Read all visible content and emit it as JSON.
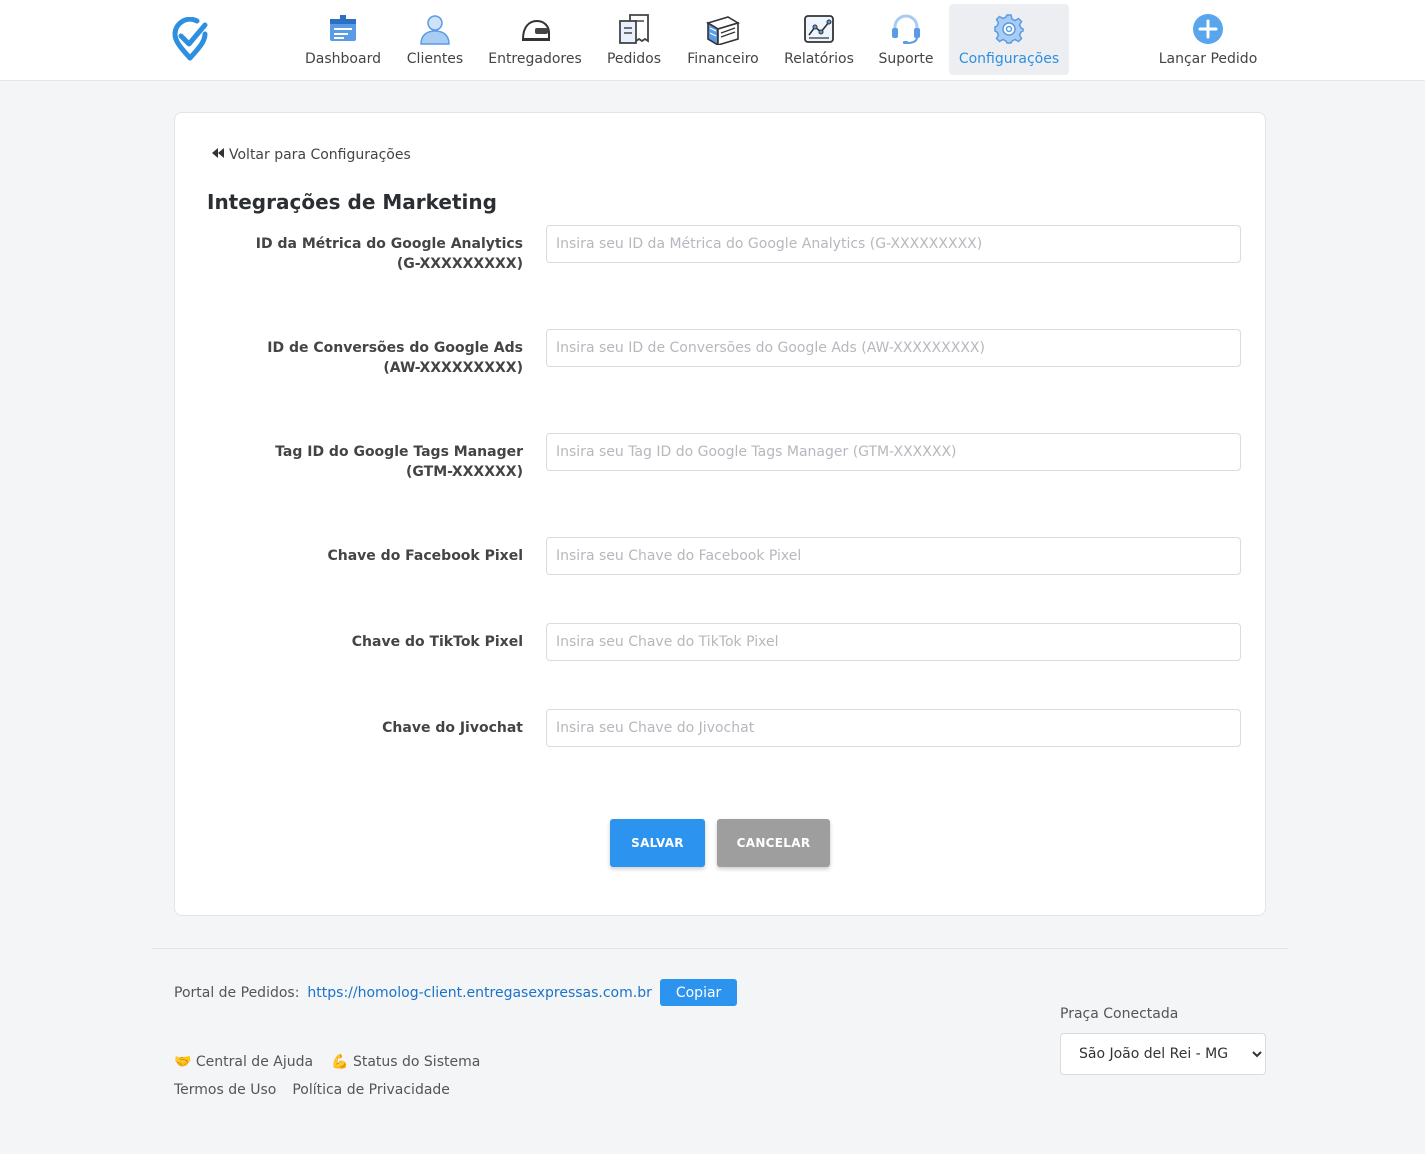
{
  "nav": {
    "items": [
      {
        "label": "Dashboard",
        "icon": "dashboard-icon"
      },
      {
        "label": "Clientes",
        "icon": "user-icon"
      },
      {
        "label": "Entregadores",
        "icon": "helmet-icon"
      },
      {
        "label": "Pedidos",
        "icon": "receipt-icon"
      },
      {
        "label": "Financeiro",
        "icon": "money-icon"
      },
      {
        "label": "Relatórios",
        "icon": "chart-icon"
      },
      {
        "label": "Suporte",
        "icon": "headset-icon"
      },
      {
        "label": "Configurações",
        "icon": "gear-icon",
        "active": true
      }
    ],
    "launch_label": "Lançar Pedido"
  },
  "back_link": "Voltar para Configurações",
  "page_title": "Integrações de Marketing",
  "fields": [
    {
      "label": "ID da Métrica do Google Analytics (G-XXXXXXXXX)",
      "placeholder": "Insira seu ID da Métrica do Google Analytics (G-XXXXXXXXX)",
      "value": ""
    },
    {
      "label": "ID de Conversões do Google Ads (AW-XXXXXXXXX)",
      "placeholder": "Insira seu ID de Conversões do Google Ads (AW-XXXXXXXXX)",
      "value": ""
    },
    {
      "label": "Tag ID do Google Tags Manager (GTM-XXXXXX)",
      "placeholder": "Insira seu Tag ID do Google Tags Manager (GTM-XXXXXX)",
      "value": ""
    },
    {
      "label": "Chave do Facebook Pixel",
      "placeholder": "Insira seu Chave do Facebook Pixel",
      "value": ""
    },
    {
      "label": "Chave do TikTok Pixel",
      "placeholder": "Insira seu Chave do TikTok Pixel",
      "value": ""
    },
    {
      "label": "Chave do Jivochat",
      "placeholder": "Insira seu Chave do Jivochat",
      "value": ""
    }
  ],
  "buttons": {
    "save": "SALVAR",
    "cancel": "CANCELAR"
  },
  "footer": {
    "portal_label": "Portal de Pedidos:",
    "portal_url": "https://homolog-client.entregasexpressas.com.br",
    "copy_label": "Copiar",
    "help": "🤝 Central de Ajuda",
    "status": "💪 Status do Sistema",
    "terms": "Termos de Uso",
    "privacy": "Política de Privacidade",
    "praca_label": "Praça Conectada",
    "praca_selected": "São João del Rei - MG"
  },
  "colors": {
    "accent": "#2c93ef",
    "active_nav_text": "#2e8fe0",
    "cancel": "#9e9e9e"
  }
}
